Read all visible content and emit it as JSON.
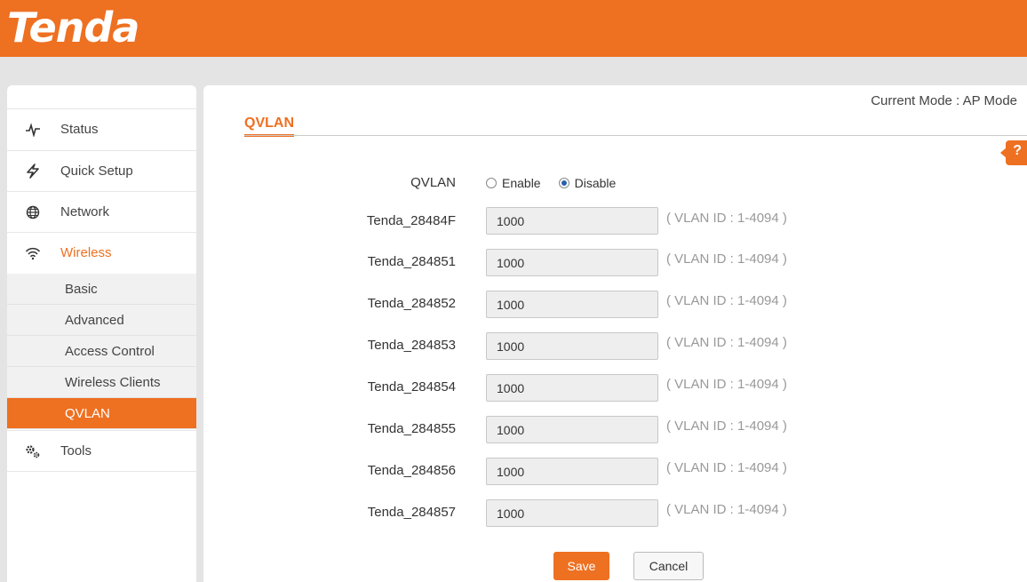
{
  "header": {
    "logo": "Tenda"
  },
  "sidebar": {
    "items": [
      {
        "label": "Status",
        "icon": "pulse-icon"
      },
      {
        "label": "Quick Setup",
        "icon": "lightning-icon"
      },
      {
        "label": "Network",
        "icon": "globe-icon"
      },
      {
        "label": "Wireless",
        "icon": "wifi-icon"
      },
      {
        "label": "Tools",
        "icon": "gears-icon"
      }
    ],
    "wireless_sub": [
      "Basic",
      "Advanced",
      "Access Control",
      "Wireless Clients",
      "QVLAN"
    ]
  },
  "main": {
    "mode": "Current Mode : AP Mode",
    "title": "QVLAN",
    "help": "?",
    "qvlan_label": "QVLAN",
    "enable_label": "Enable",
    "disable_label": "Disable",
    "selected": "Disable",
    "rows": [
      {
        "name": "Tenda_28484F",
        "value": "1000",
        "hint": "( VLAN ID : 1-4094 )"
      },
      {
        "name": "Tenda_284851",
        "value": "1000",
        "hint": "( VLAN ID : 1-4094 )"
      },
      {
        "name": "Tenda_284852",
        "value": "1000",
        "hint": "( VLAN ID : 1-4094 )"
      },
      {
        "name": "Tenda_284853",
        "value": "1000",
        "hint": "( VLAN ID : 1-4094 )"
      },
      {
        "name": "Tenda_284854",
        "value": "1000",
        "hint": "( VLAN ID : 1-4094 )"
      },
      {
        "name": "Tenda_284855",
        "value": "1000",
        "hint": "( VLAN ID : 1-4094 )"
      },
      {
        "name": "Tenda_284856",
        "value": "1000",
        "hint": "( VLAN ID : 1-4094 )"
      },
      {
        "name": "Tenda_284857",
        "value": "1000",
        "hint": "( VLAN ID : 1-4094 )"
      }
    ],
    "save_label": "Save",
    "cancel_label": "Cancel"
  },
  "colors": {
    "accent": "#ee7021",
    "background": "#e4e4e4"
  }
}
